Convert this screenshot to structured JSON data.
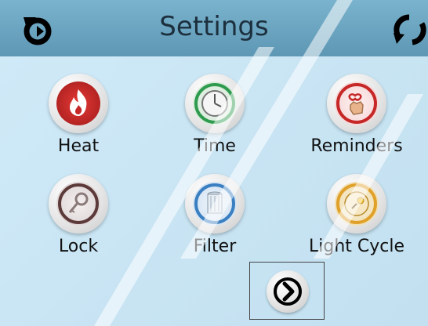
{
  "header": {
    "title": "Settings",
    "back_icon": "back-icon",
    "refresh_icon": "refresh-icon",
    "color": "#6aa6c3"
  },
  "items": [
    {
      "label": "Heat",
      "icon": "heat-icon",
      "color": "#c62828"
    },
    {
      "label": "Time",
      "icon": "time-icon",
      "color": "#2e9b4e"
    },
    {
      "label": "Reminders",
      "icon": "reminders-icon",
      "color": "#c62828"
    },
    {
      "label": "Lock",
      "icon": "lock-icon",
      "color": "#5d3a3a"
    },
    {
      "label": "Filter",
      "icon": "filter-icon",
      "color": "#3a7fc1"
    },
    {
      "label": "Light Cycle",
      "icon": "light-cycle-icon",
      "color": "#e0a12a"
    }
  ],
  "next_icon": "next-arrow-icon",
  "background": "#cfe8f5"
}
